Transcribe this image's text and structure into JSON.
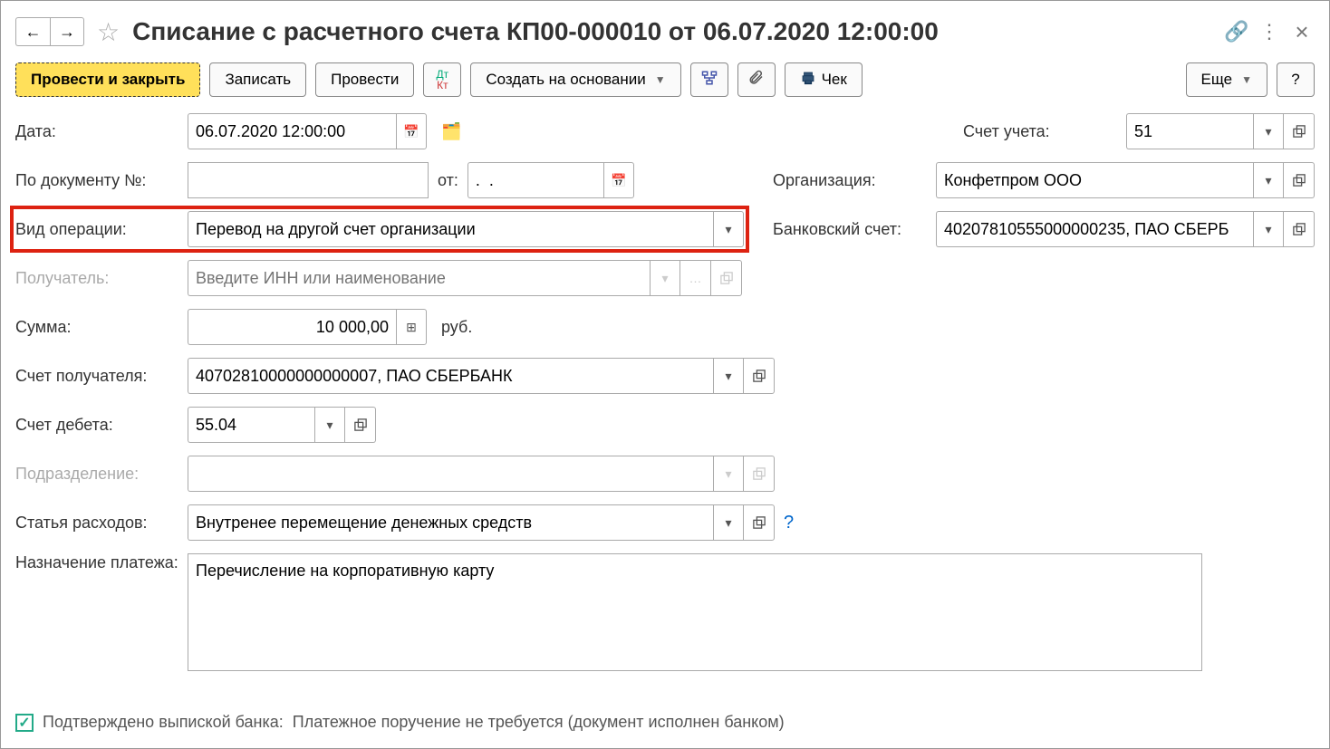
{
  "title": "Списание с расчетного счета КП00-000010 от 06.07.2020 12:00:00",
  "toolbar": {
    "post_close": "Провести и закрыть",
    "save": "Записать",
    "post": "Провести",
    "create_based": "Создать на основании",
    "check": "Чек",
    "more": "Еще",
    "help": "?"
  },
  "labels": {
    "date": "Дата:",
    "doc_no": "По документу №:",
    "from": "от:",
    "op_type": "Вид операции:",
    "recipient": "Получатель:",
    "amount": "Сумма:",
    "currency": "руб.",
    "recipient_acc": "Счет получателя:",
    "debit_acc": "Счет дебета:",
    "department": "Подразделение:",
    "expense_item": "Статья расходов:",
    "purpose": "Назначение платежа:",
    "account": "Счет учета:",
    "organization": "Организация:",
    "bank_account": "Банковский счет:"
  },
  "values": {
    "date": "06.07.2020 12:00:00",
    "doc_no": "",
    "from_date": ".  .",
    "op_type": "Перевод на другой счет организации",
    "recipient_placeholder": "Введите ИНН или наименование",
    "amount": "10 000,00",
    "recipient_acc": "40702810000000000007, ПАО СБЕРБАНК",
    "debit_acc": "55.04",
    "department": "",
    "expense_item": "Внутренее перемещение денежных средств",
    "purpose": "Перечисление на корпоративную карту",
    "account": "51",
    "organization": "Конфетпром ООО",
    "bank_account": "40207810555000000235, ПАО СБЕРБ"
  },
  "footer": {
    "confirmed_label": "Подтверждено выпиской банка:",
    "note": "Платежное поручение не требуется (документ исполнен банком)"
  }
}
